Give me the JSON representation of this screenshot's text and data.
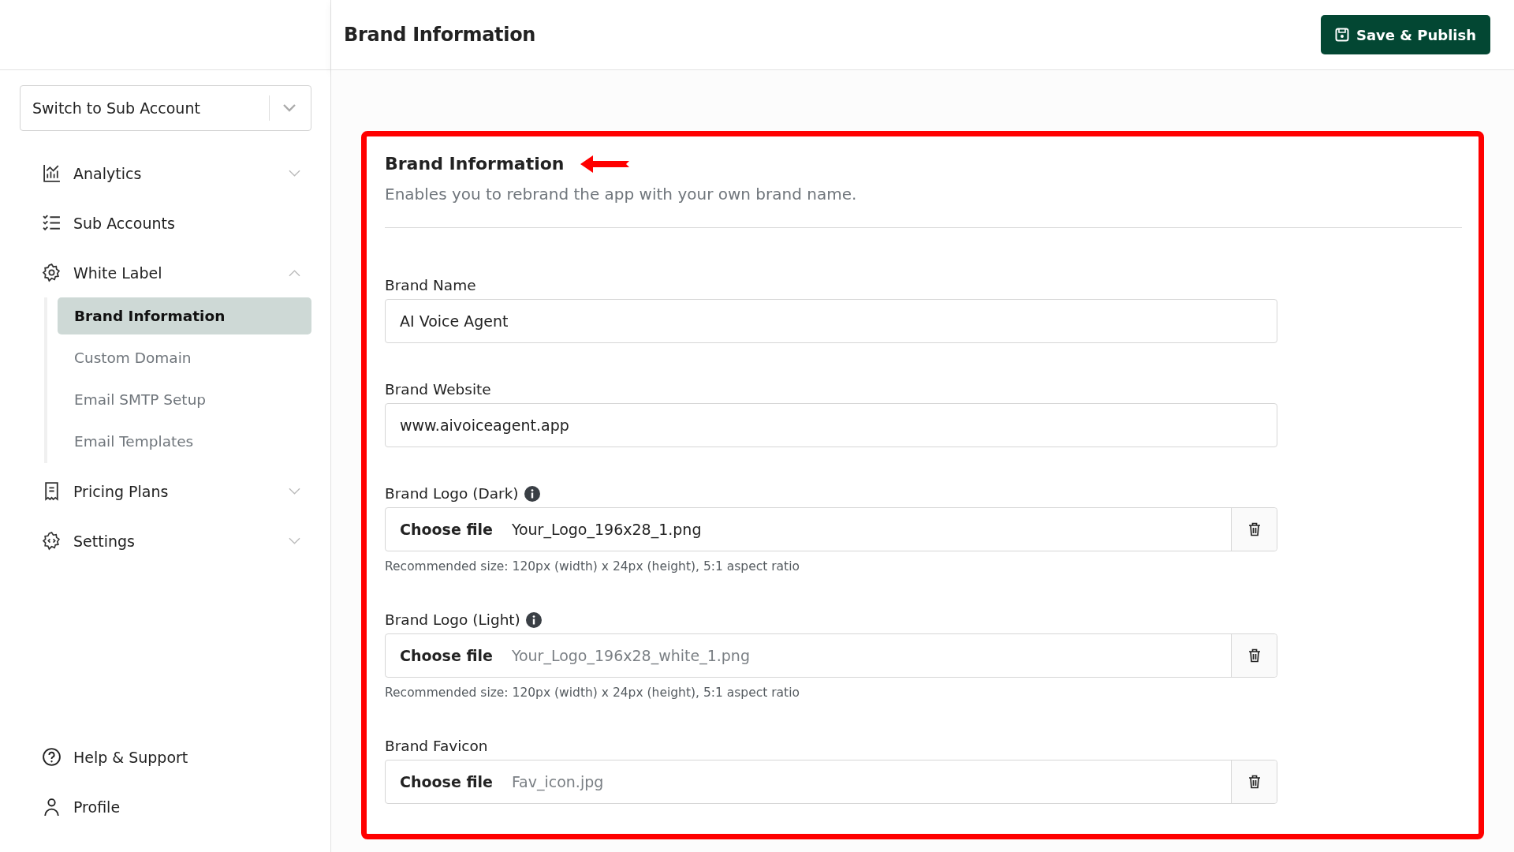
{
  "header": {
    "title": "Brand Information",
    "save_button": "Save & Publish"
  },
  "sidebar": {
    "account_switcher": {
      "placeholder": "Switch to Sub Account"
    },
    "items": [
      {
        "kind": "analytics",
        "label": "Analytics",
        "expanded": false
      },
      {
        "kind": "accounts",
        "label": "Sub Accounts"
      },
      {
        "kind": "whitelabel",
        "label": "White Label",
        "expanded": true,
        "children": [
          {
            "label": "Brand Information",
            "selected": true
          },
          {
            "label": "Custom Domain",
            "selected": false
          },
          {
            "label": "Email SMTP Setup",
            "selected": false
          },
          {
            "label": "Email Templates",
            "selected": false
          }
        ]
      },
      {
        "kind": "pricing",
        "label": "Pricing Plans",
        "expanded": false
      },
      {
        "kind": "settings",
        "label": "Settings",
        "expanded": false
      }
    ],
    "footer_items": [
      {
        "kind": "help",
        "label": "Help & Support"
      },
      {
        "kind": "profile",
        "label": "Profile"
      }
    ]
  },
  "card": {
    "title": "Brand Information",
    "description": "Enables you to rebrand the app with your own brand name.",
    "fields": [
      {
        "kind": "text",
        "label": "Brand Name",
        "value": "AI Voice Agent"
      },
      {
        "kind": "text",
        "label": "Brand Website",
        "value": "www.aivoiceagent.app"
      },
      {
        "kind": "file",
        "label": "Brand Logo (Dark)",
        "info": true,
        "button": "Choose file",
        "value": "Your_Logo_196x28_1.png",
        "hint": "Recommended size: 120px (width) x 24px (height), 5:1 aspect ratio"
      },
      {
        "kind": "file",
        "label": "Brand Logo (Light)",
        "info": true,
        "button": "Choose file",
        "placeholder": "Your_Logo_196x28_white_1.png",
        "hint": "Recommended size: 120px (width) x 24px (height), 5:1 aspect ratio"
      },
      {
        "kind": "file",
        "label": "Brand Favicon",
        "button": "Choose file",
        "placeholder": "Fav_icon.jpg"
      }
    ]
  }
}
